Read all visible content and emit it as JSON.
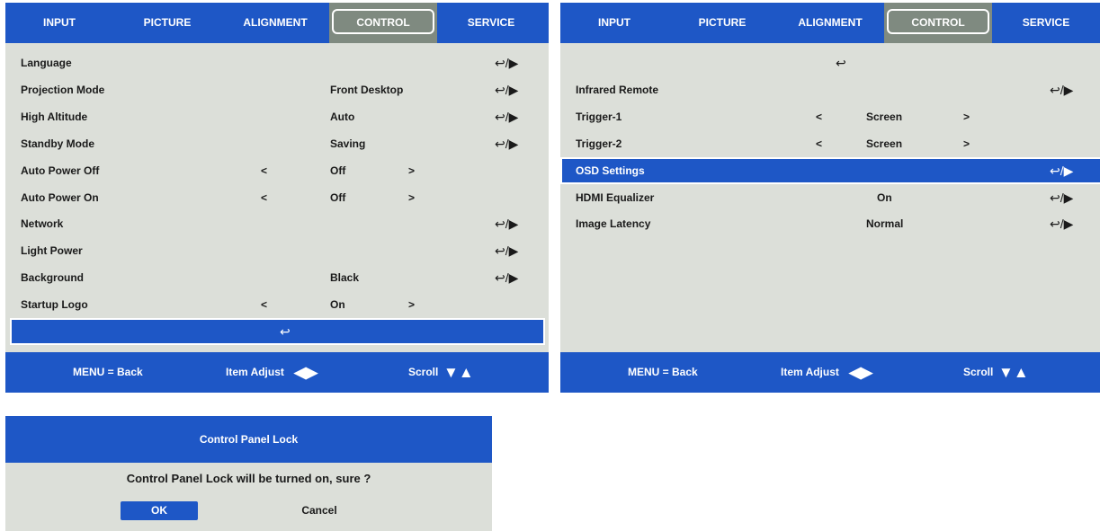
{
  "tabs": [
    "INPUT",
    "PICTURE",
    "ALIGNMENT",
    "CONTROL",
    "SERVICE"
  ],
  "active_tab": "CONTROL",
  "panel1": {
    "rows": [
      {
        "label": "Language",
        "left_arrow": "",
        "value": "",
        "right_arrow": "",
        "action": "↩/▶"
      },
      {
        "label": "Projection Mode",
        "left_arrow": "",
        "value": "Front Desktop",
        "right_arrow": "",
        "action": "↩/▶"
      },
      {
        "label": "High Altitude",
        "left_arrow": "",
        "value": "Auto",
        "right_arrow": "",
        "action": "↩/▶"
      },
      {
        "label": "Standby Mode",
        "left_arrow": "",
        "value": "Saving",
        "right_arrow": "",
        "action": "↩/▶"
      },
      {
        "label": "Auto Power Off",
        "left_arrow": "<",
        "value": "Off",
        "right_arrow": ">",
        "action": ""
      },
      {
        "label": "Auto Power On",
        "left_arrow": "<",
        "value": "Off",
        "right_arrow": ">",
        "action": ""
      },
      {
        "label": "Network",
        "left_arrow": "",
        "value": "",
        "right_arrow": "",
        "action": "↩/▶"
      },
      {
        "label": "Light Power",
        "left_arrow": "",
        "value": "",
        "right_arrow": "",
        "action": "↩/▶"
      },
      {
        "label": "Background",
        "left_arrow": "",
        "value": "Black",
        "right_arrow": "",
        "action": "↩/▶"
      },
      {
        "label": "Startup Logo",
        "left_arrow": "<",
        "value": "On",
        "right_arrow": ">",
        "action": ""
      }
    ],
    "back_row_symbol": "↩"
  },
  "panel2": {
    "top_symbol": "↩",
    "rows": [
      {
        "label": "Infrared Remote",
        "left_arrow": "",
        "value": "",
        "right_arrow": "",
        "action": "↩/▶",
        "selected": false
      },
      {
        "label": "Trigger-1",
        "left_arrow": "<",
        "value": "Screen",
        "right_arrow": ">",
        "action": "",
        "selected": false
      },
      {
        "label": "Trigger-2",
        "left_arrow": "<",
        "value": "Screen",
        "right_arrow": ">",
        "action": "",
        "selected": false
      },
      {
        "label": "OSD Settings",
        "left_arrow": "",
        "value": "",
        "right_arrow": "",
        "action": "↩/▶",
        "selected": true
      },
      {
        "label": "HDMI Equalizer",
        "left_arrow": "",
        "value": "On",
        "right_arrow": "",
        "action": "↩/▶",
        "selected": false
      },
      {
        "label": "Image Latency",
        "left_arrow": "",
        "value": "Normal",
        "right_arrow": "",
        "action": "↩/▶",
        "selected": false
      }
    ]
  },
  "footer": {
    "menu_back": "MENU = Back",
    "item_adjust": "Item Adjust",
    "scroll": "Scroll"
  },
  "dialog": {
    "title": "Control Panel Lock",
    "message": "Control Panel Lock will be turned on, sure ?",
    "ok_label": "OK",
    "cancel_label": "Cancel"
  },
  "colors": {
    "menu_blue": "#1e57c6",
    "panel_bg": "#dcdfd9",
    "active_tab_bg": "#7f8a80"
  }
}
